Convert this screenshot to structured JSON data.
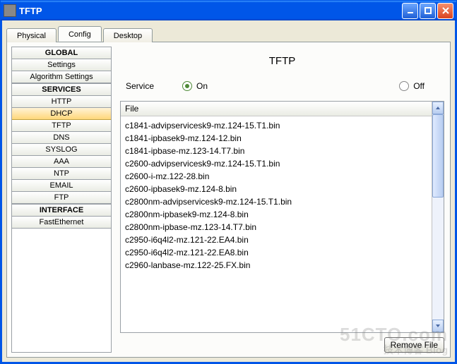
{
  "window": {
    "title": "TFTP"
  },
  "tabs": {
    "physical": "Physical",
    "config": "Config",
    "desktop": "Desktop",
    "active": "config"
  },
  "sidebar": {
    "s0": {
      "heading": "GLOBAL"
    },
    "s0_items": {
      "0": "Settings",
      "1": "Algorithm Settings"
    },
    "s1": {
      "heading": "SERVICES"
    },
    "s1_items": {
      "0": "HTTP",
      "1": "DHCP",
      "2": "TFTP",
      "3": "DNS",
      "4": "SYSLOG",
      "5": "AAA",
      "6": "NTP",
      "7": "EMAIL",
      "8": "FTP"
    },
    "s2": {
      "heading": "INTERFACE"
    },
    "s2_items": {
      "0": "FastEthernet"
    },
    "selected": "DHCP"
  },
  "main": {
    "title": "TFTP",
    "service_label": "Service",
    "on_label": "On",
    "off_label": "Off",
    "service_state": "On",
    "file_header": "File",
    "remove_btn": "Remove File"
  },
  "files": {
    "0": "c1841-advipservicesk9-mz.124-15.T1.bin",
    "1": "c1841-ipbasek9-mz.124-12.bin",
    "2": "c1841-ipbase-mz.123-14.T7.bin",
    "3": "c2600-advipservicesk9-mz.124-15.T1.bin",
    "4": "c2600-i-mz.122-28.bin",
    "5": "c2600-ipbasek9-mz.124-8.bin",
    "6": "c2800nm-advipservicesk9-mz.124-15.T1.bin",
    "7": "c2800nm-ipbasek9-mz.124-8.bin",
    "8": "c2800nm-ipbase-mz.123-14.T7.bin",
    "9": "c2950-i6q4l2-mz.121-22.EA4.bin",
    "10": "c2950-i6q4l2-mz.121-22.EA8.bin",
    "11": "c2960-lanbase-mz.122-25.FX.bin"
  },
  "watermark": {
    "line1": "51CTO.com",
    "line2": "技术博客    Blog"
  }
}
